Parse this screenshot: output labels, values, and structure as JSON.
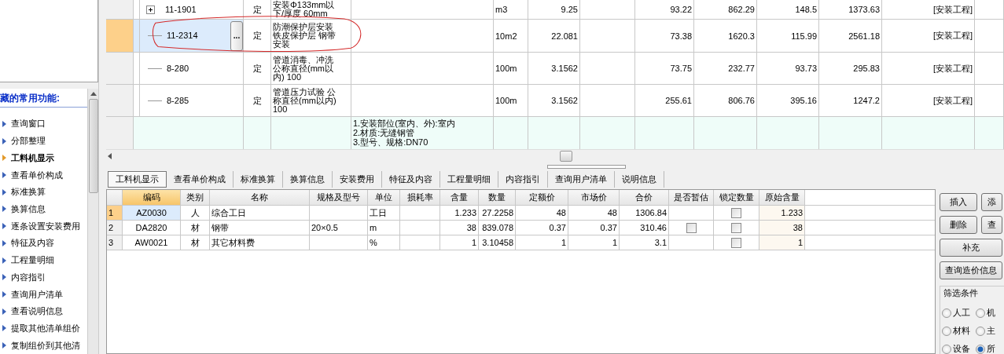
{
  "sidebar": {
    "heading": "藏的常用功能:",
    "items": [
      {
        "label": "查询窗口",
        "selected": false
      },
      {
        "label": "分部整理",
        "selected": false
      },
      {
        "label": "工料机显示",
        "selected": true
      },
      {
        "label": "查看单价构成",
        "selected": false
      },
      {
        "label": "标准换算",
        "selected": false
      },
      {
        "label": "换算信息",
        "selected": false
      },
      {
        "label": "逐条设置安装费用",
        "selected": false
      },
      {
        "label": "特征及内容",
        "selected": false
      },
      {
        "label": "工程量明细",
        "selected": false
      },
      {
        "label": "内容指引",
        "selected": false
      },
      {
        "label": "查询用户清单",
        "selected": false
      },
      {
        "label": "查看说明信息",
        "selected": false
      },
      {
        "label": "提取其他清单组价",
        "selected": false
      },
      {
        "label": "复制组价到其他清",
        "selected": false
      }
    ]
  },
  "top_rows": [
    {
      "kind": "item",
      "code": "11-1901",
      "expandable": true,
      "type": "定",
      "name": "安装Φ133mm以下/厚度 60mm",
      "unit": "m3",
      "qty": "9.25",
      "prices": [
        "93.22",
        "862.29",
        "148.5",
        "1373.63"
      ],
      "category": "[安装工程]",
      "selected": false
    },
    {
      "kind": "item",
      "code": "11-2314",
      "expandable": false,
      "more_button": "...",
      "type": "定",
      "name": "防潮保护层安装铁皮保护层 钢带安装",
      "unit": "10m2",
      "qty": "22.081",
      "prices": [
        "73.38",
        "1620.3",
        "115.99",
        "2561.18"
      ],
      "category": "[安装工程]",
      "selected": true
    },
    {
      "kind": "item",
      "code": "8-280",
      "expandable": false,
      "type": "定",
      "name": "管道消毒、冲洗公称直径(mm以内) 100",
      "unit": "100m",
      "qty": "3.1562",
      "prices": [
        "73.75",
        "232.77",
        "93.73",
        "295.83"
      ],
      "category": "[安装工程]",
      "selected": false
    },
    {
      "kind": "item",
      "code": "8-285",
      "expandable": false,
      "type": "定",
      "name": "管道压力试验 公称直径(mm以内) 100",
      "unit": "100m",
      "qty": "3.1562",
      "prices": [
        "255.61",
        "806.76",
        "395.16",
        "1247.2"
      ],
      "category": "[安装工程]",
      "selected": false
    },
    {
      "kind": "feature",
      "lines": [
        "1.安装部位(室内、外):室内",
        "2.材质:无缝钢管",
        "3.型号、规格:DN70"
      ]
    }
  ],
  "tabs": [
    {
      "label": "工料机显示",
      "selected": true
    },
    {
      "label": "查看单价构成",
      "selected": false
    },
    {
      "label": "标准换算",
      "selected": false
    },
    {
      "label": "换算信息",
      "selected": false
    },
    {
      "label": "安装费用",
      "selected": false
    },
    {
      "label": "特征及内容",
      "selected": false
    },
    {
      "label": "工程量明细",
      "selected": false
    },
    {
      "label": "内容指引",
      "selected": false
    },
    {
      "label": "查询用户清单",
      "selected": false
    },
    {
      "label": "说明信息",
      "selected": false
    }
  ],
  "materials": {
    "columns": [
      {
        "label": "编码",
        "selected": true
      },
      {
        "label": "类别",
        "selected": false
      },
      {
        "label": "名称",
        "selected": false
      },
      {
        "label": "规格及型号",
        "selected": false
      },
      {
        "label": "单位",
        "selected": false
      },
      {
        "label": "损耗率",
        "selected": false
      },
      {
        "label": "含量",
        "selected": false
      },
      {
        "label": "数量",
        "selected": false
      },
      {
        "label": "定额价",
        "selected": false
      },
      {
        "label": "市场价",
        "selected": false
      },
      {
        "label": "合价",
        "selected": false
      },
      {
        "label": "是否暂估",
        "selected": false
      },
      {
        "label": "锁定数量",
        "selected": false
      },
      {
        "label": "原始含量",
        "selected": false
      }
    ],
    "rows": [
      {
        "index": "1",
        "code": "AZ0030",
        "type": "人",
        "name": "综合工日",
        "unit": "工日",
        "content": "1.233",
        "qty": "27.2258",
        "quota_price": "48",
        "market_price": "48",
        "total": "1306.84",
        "locked": false,
        "original": "1.233",
        "selected": true
      },
      {
        "index": "2",
        "code": "DA2820",
        "type": "材",
        "name": "钢带",
        "spec": "20×0.5",
        "unit": "m",
        "content": "38",
        "qty": "839.078",
        "quota_price": "0.37",
        "market_price": "0.37",
        "total": "310.46",
        "estimated": false,
        "locked": false,
        "original": "38",
        "selected": false
      },
      {
        "index": "3",
        "code": "AW0021",
        "type": "材",
        "name": "其它材料费",
        "unit": "%",
        "content": "1",
        "qty": "3.10458",
        "quota_price": "1",
        "market_price": "1",
        "total": "3.1",
        "locked": false,
        "original": "1",
        "selected": false
      }
    ]
  },
  "actions": [
    {
      "label": "插入",
      "wide": false
    },
    {
      "label": "添",
      "wide": false
    },
    {
      "label": "删除",
      "wide": false
    },
    {
      "label": "查",
      "wide": false
    },
    {
      "label": "补充",
      "wide": true
    },
    {
      "label": "查询造价信息",
      "wide": true
    }
  ],
  "filter": {
    "title": "筛选条件",
    "options": [
      {
        "label": "人工",
        "selected": false
      },
      {
        "label": "机",
        "selected": false
      },
      {
        "label": "材料",
        "selected": false
      },
      {
        "label": "主",
        "selected": false
      },
      {
        "label": "设备",
        "selected": false
      },
      {
        "label": "所",
        "selected": true
      }
    ]
  }
}
